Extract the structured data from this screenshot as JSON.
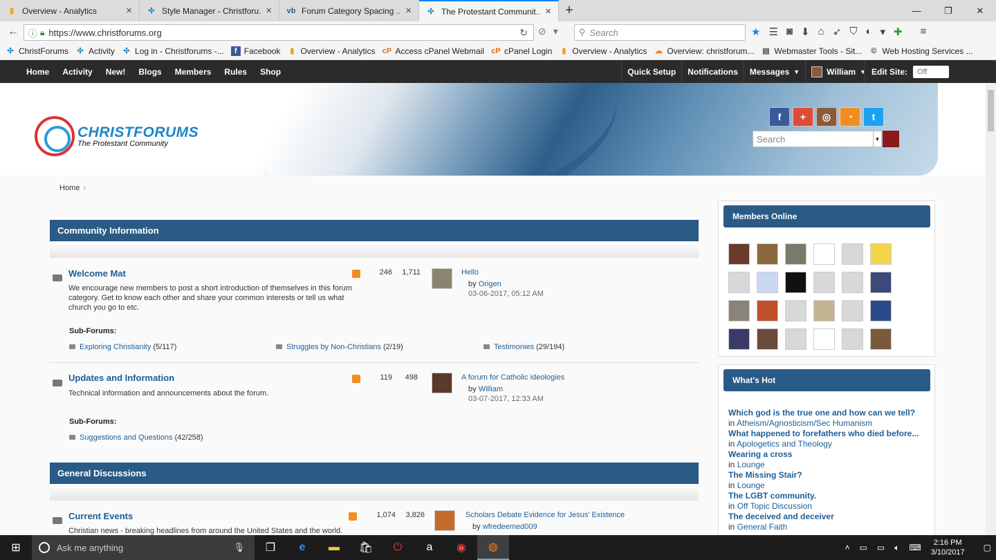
{
  "browser": {
    "tabs": [
      {
        "title": "Overview - Analytics",
        "icon": "analytics-icon",
        "color": "#f4a11c"
      },
      {
        "title": "Style Manager - Christforu...",
        "icon": "christforums-icon",
        "color": "#1d86c7"
      },
      {
        "title": "Forum Category Spacing ...",
        "icon": "vbulletin-icon",
        "color": "#2b5a8a"
      },
      {
        "title": "The Protestant Communit...",
        "icon": "christforums-icon",
        "color": "#1d86c7"
      }
    ],
    "url": "https://www.christforums.org",
    "search_placeholder": "Search",
    "bookmarks": [
      {
        "label": "ChristForums"
      },
      {
        "label": "Activity"
      },
      {
        "label": "Log in - Christforums -..."
      },
      {
        "label": "Facebook"
      },
      {
        "label": "Overview - Analytics"
      },
      {
        "label": "Access cPanel Webmail"
      },
      {
        "label": "cPanel Login"
      },
      {
        "label": "Overview - Analytics"
      },
      {
        "label": "Overview: christforum..."
      },
      {
        "label": "Webmaster Tools - Sit..."
      },
      {
        "label": "Web Hosting Services ..."
      }
    ]
  },
  "sitenav": {
    "left": [
      "Home",
      "Activity",
      "New!",
      "Blogs",
      "Members",
      "Rules",
      "Shop"
    ],
    "quick_setup": "Quick Setup",
    "notifications": "Notifications",
    "messages": "Messages",
    "user": "William",
    "edit_site": "Edit Site:",
    "edit_toggle": "Off"
  },
  "header": {
    "logo_line1": "CHRISTFORUMS",
    "logo_line2": "The Protestant Community",
    "search_placeholder": "Search"
  },
  "breadcrumb": {
    "home": "Home"
  },
  "categories": [
    {
      "title": "Community Information"
    },
    {
      "title": "General Discussions"
    }
  ],
  "forums": [
    {
      "title": "Welcome Mat",
      "desc": "We encourage new members to post a short introduction of themselves in this forum category. Get to know each other and share your common interests or tell us what church you go to etc.",
      "threads": "246",
      "posts": "1,711",
      "last_title": "Hello",
      "by": "by",
      "last_user": "Origen",
      "last_date": "03-06-2017, 05:12 AM",
      "sub_label": "Sub-Forums:",
      "subs": [
        {
          "name": "Exploring Christianity",
          "count": "(5/117)"
        },
        {
          "name": "Struggles by Non-Christians",
          "count": "(2/19)"
        },
        {
          "name": "Testimonies",
          "count": "(29/194)"
        }
      ]
    },
    {
      "title": "Updates and Information",
      "desc": "Technical information and announcements about the forum.",
      "threads": "119",
      "posts": "498",
      "last_title": "A forum for Catholic ideologies",
      "by": "by",
      "last_user": "William",
      "last_date": "03-07-2017, 12:33 AM",
      "sub_label": "Sub-Forums:",
      "subs": [
        {
          "name": "Suggestions and Questions",
          "count": "(42/258)"
        }
      ]
    },
    {
      "title": "Current Events",
      "desc": "Christian news - breaking headlines from around the United States and the world.",
      "threads": "1,074",
      "posts": "3,826",
      "last_title": "Scholars Debate Evidence for Jesus' Existence",
      "by": "by",
      "last_user": "wfredeemed009"
    }
  ],
  "sidebar": {
    "members_online_title": "Members Online",
    "whats_hot_title": "What's Hot",
    "hot": [
      {
        "q": "Which god is the true one and how can we tell?",
        "in": "in",
        "forum": "Atheism/Agnosticism/Sec Humanism"
      },
      {
        "q": "What happened to forefathers who died before...",
        "in": "in",
        "forum": "Apologetics and Theology"
      },
      {
        "q": "Wearing a cross",
        "in": "in",
        "forum": "Lounge"
      },
      {
        "q": "The Missing Stair?",
        "in": "in",
        "forum": "Lounge"
      },
      {
        "q": "The LGBT community.",
        "in": "in",
        "forum": "Off Topic Discussion"
      },
      {
        "q": "The deceived and deceiver",
        "in": "in",
        "forum": "General Faith"
      }
    ]
  },
  "taskbar": {
    "search_placeholder": "Ask me anything",
    "time": "2:16 PM",
    "date": "3/10/2017"
  }
}
